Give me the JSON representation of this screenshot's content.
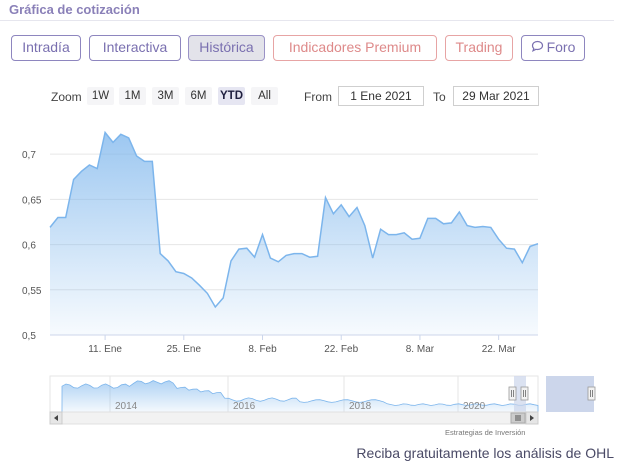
{
  "header": {
    "title": "Gráfica de cotización"
  },
  "tabs": [
    {
      "label": "Intradía"
    },
    {
      "label": "Interactiva"
    },
    {
      "label": "Histórica"
    },
    {
      "label": "Indicadores Premium"
    },
    {
      "label": "Trading"
    },
    {
      "label": "Foro",
      "icon": "chat-bubble-icon"
    }
  ],
  "toolbar": {
    "zoom_label": "Zoom",
    "zoom_options": [
      "1W",
      "1M",
      "3M",
      "6M",
      "YTD",
      "All"
    ],
    "zoom_selected": "YTD",
    "from_label": "From",
    "from_value": "1 Ene 2021",
    "to_label": "To",
    "to_value": "29 Mar 2021"
  },
  "chart_data": {
    "type": "area",
    "y_ticks": [
      "0,7",
      "0,65",
      "0,6",
      "0,55",
      "0,5"
    ],
    "ylim": [
      0.5,
      0.74
    ],
    "x_tick_labels": [
      "11. Ene",
      "25. Ene",
      "8. Feb",
      "22. Feb",
      "8. Mar",
      "22. Mar"
    ],
    "series": [
      {
        "values": [
          0.619,
          0.63,
          0.63,
          0.672,
          0.681,
          0.688,
          0.684,
          0.724,
          0.713,
          0.722,
          0.718,
          0.698,
          0.692,
          0.692,
          0.59,
          0.582,
          0.57,
          0.568,
          0.563,
          0.555,
          0.546,
          0.531,
          0.541,
          0.582,
          0.595,
          0.596,
          0.586,
          0.611,
          0.585,
          0.581,
          0.588,
          0.59,
          0.59,
          0.586,
          0.587,
          0.652,
          0.634,
          0.644,
          0.631,
          0.641,
          0.621,
          0.585,
          0.617,
          0.611,
          0.611,
          0.613,
          0.606,
          0.607,
          0.629,
          0.629,
          0.623,
          0.624,
          0.636,
          0.621,
          0.619,
          0.62,
          0.619,
          0.606,
          0.596,
          0.595,
          0.58,
          0.598,
          0.601
        ]
      }
    ],
    "navigator": {
      "year_labels": [
        "2014",
        "2016",
        "2018",
        "2020"
      ]
    },
    "credit": "Estrategias de Inversión",
    "colors": {
      "line": "#7cb5ec",
      "fill_top": "#7cb5ec",
      "navigator_mask": "#ccd6eb"
    }
  },
  "footer": {
    "text": "Reciba gratuitamente los análisis de OHL"
  }
}
